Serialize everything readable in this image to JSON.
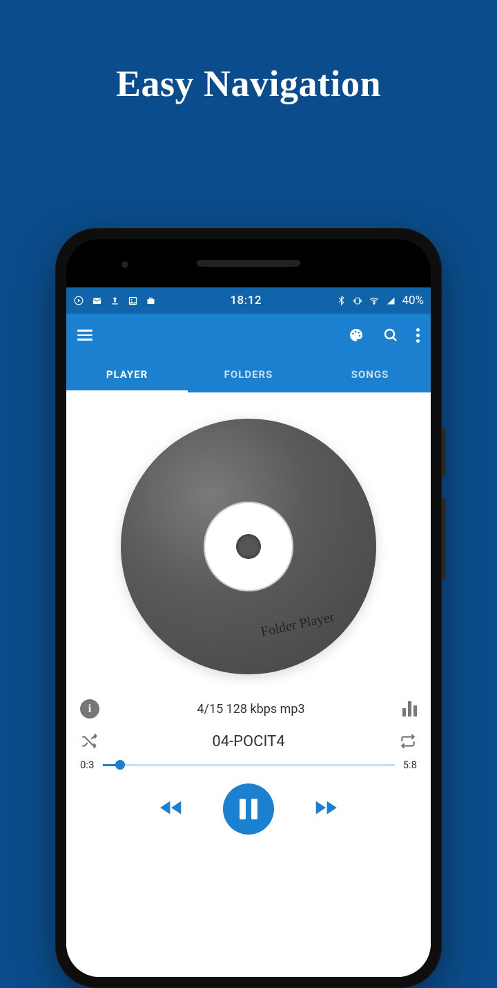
{
  "hero": {
    "title": "Easy Navigation"
  },
  "status": {
    "time": "18:12",
    "battery": "40%"
  },
  "tabs": {
    "items": [
      "PLAYER",
      "FOLDERS",
      "SONGS"
    ],
    "active_index": 0
  },
  "player": {
    "disc_label": "Folder Player",
    "track_meta": "4/15 128 kbps mp3",
    "track_title": "04-POCIT4",
    "elapsed": "0:3",
    "total": "5:8",
    "progress_percent": 6
  }
}
